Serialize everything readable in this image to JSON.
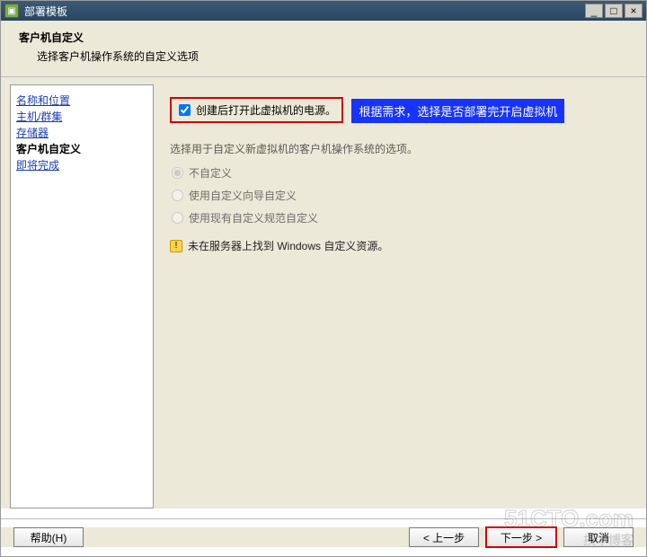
{
  "window": {
    "title": "部署模板",
    "min": "_",
    "max": "□",
    "close": "×"
  },
  "header": {
    "title": "客户机自定义",
    "subtitle": "选择客户机操作系统的自定义选项"
  },
  "sidebar": {
    "items": [
      {
        "label": "名称和位置",
        "link": true
      },
      {
        "label": "主机/群集",
        "link": true
      },
      {
        "label": "存储器",
        "link": true
      },
      {
        "label": "客户机自定义",
        "current": true
      },
      {
        "label": "即将完成",
        "link": true
      }
    ]
  },
  "main": {
    "checkbox_label": "创建后打开此虚拟机的电源。",
    "annotation": "根据需求，选择是否部署完开启虚拟机",
    "desc": "选择用于自定义新虚拟机的客户机操作系统的选项。",
    "radios": [
      {
        "label": "不自定义",
        "checked": true
      },
      {
        "label": "使用自定义向导自定义",
        "checked": false
      },
      {
        "label": "使用现有自定义规范自定义",
        "checked": false
      }
    ],
    "warning": "未在服务器上找到 Windows 自定义资源。"
  },
  "footer": {
    "help": "帮助(H)",
    "back": "< 上一步",
    "next": "下一步 >",
    "cancel": "取消"
  },
  "watermark": {
    "big": "51CTO.com",
    "small": "技术博客"
  }
}
